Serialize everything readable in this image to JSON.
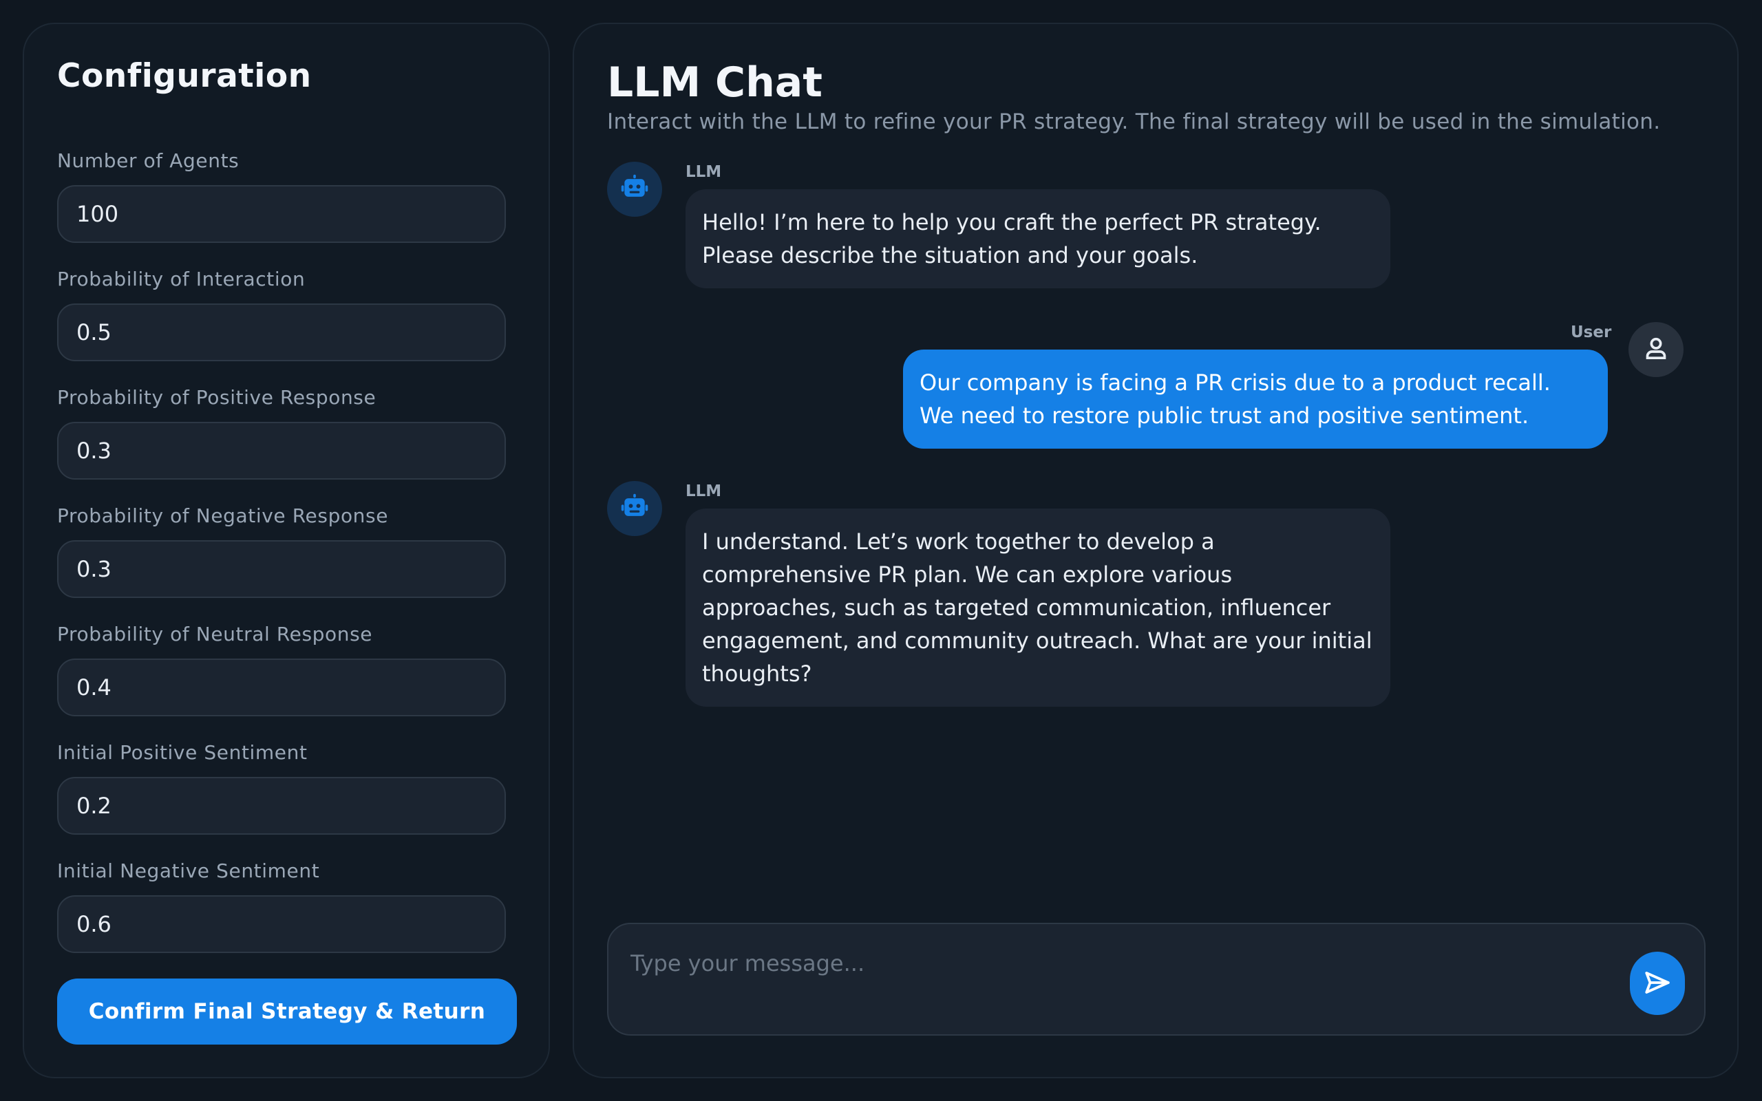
{
  "config": {
    "title": "Configuration",
    "fields": [
      {
        "label": "Number of Agents",
        "value": "100"
      },
      {
        "label": "Probability of Interaction",
        "value": "0.5"
      },
      {
        "label": "Probability of Positive Response",
        "value": "0.3"
      },
      {
        "label": "Probability of Negative Response",
        "value": "0.3"
      },
      {
        "label": "Probability of Neutral Response",
        "value": "0.4"
      },
      {
        "label": "Initial Positive Sentiment",
        "value": "0.2"
      },
      {
        "label": "Initial Negative Sentiment",
        "value": "0.6"
      }
    ],
    "confirm_label": "Confirm Final Strategy & Return"
  },
  "chat": {
    "title": "LLM Chat",
    "subtitle": "Interact with the LLM to refine your PR strategy. The final strategy will be used in the simulation.",
    "messages": [
      {
        "sender": "LLM",
        "role": "bot",
        "avatar_icon": "robot-icon",
        "text": "Hello! I’m here to help you craft the perfect PR strategy. Please describe the situation and your goals."
      },
      {
        "sender": "User",
        "role": "user",
        "avatar_icon": "user-icon",
        "text": "Our company is facing a PR crisis due to a product recall. We need to restore public trust and positive sentiment."
      },
      {
        "sender": "LLM",
        "role": "bot",
        "avatar_icon": "robot-icon",
        "text": "I understand. Let’s work together to develop a comprehensive PR plan. We can explore various approaches, such as targeted communication, influencer engagement, and community outreach. What are your initial thoughts?"
      }
    ],
    "input_placeholder": "Type your message...",
    "send_icon": "send-icon"
  },
  "colors": {
    "background": "#0f1720",
    "panel": "#111a24",
    "accent": "#1580e6",
    "bot_bubble": "#1c2532"
  }
}
